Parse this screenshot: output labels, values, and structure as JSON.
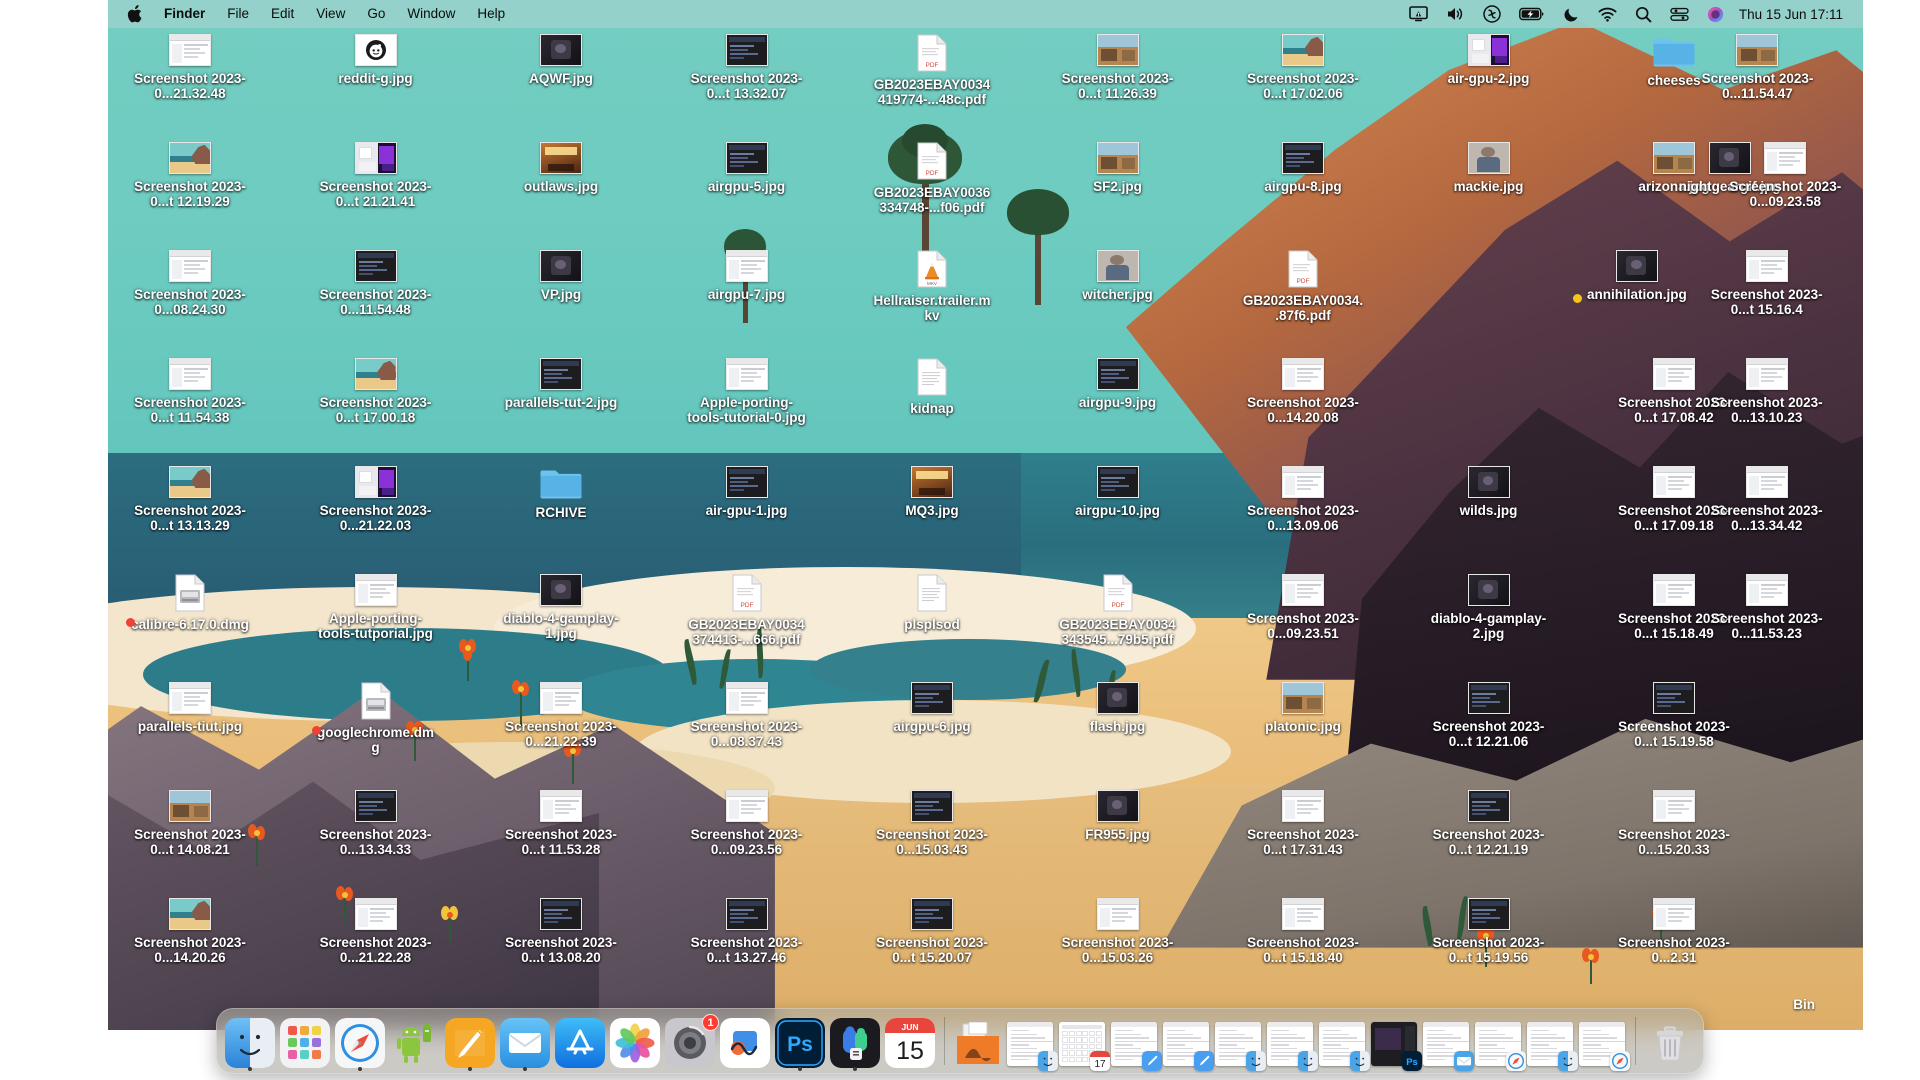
{
  "menubar": {
    "apple_icon": "apple-logo-icon",
    "items": [
      {
        "label": "Finder",
        "bold": true
      },
      {
        "label": "File",
        "bold": false
      },
      {
        "label": "Edit",
        "bold": false
      },
      {
        "label": "View",
        "bold": false
      },
      {
        "label": "Go",
        "bold": false
      },
      {
        "label": "Window",
        "bold": false
      },
      {
        "label": "Help",
        "bold": false
      }
    ],
    "status_icons": [
      "screen-mirroring-icon",
      "volume-icon",
      "creative-cloud-icon",
      "battery-charging-icon",
      "do-not-disturb-moon-icon",
      "wifi-icon",
      "spotlight-search-icon",
      "control-center-icon",
      "siri-icon"
    ],
    "clock": "Thu 15 Jun  17:11"
  },
  "desktop": {
    "icons": [
      {
        "name": "Screenshot 2023-0...21.32.48",
        "type": "screenshot-light",
        "col": 0,
        "row": 0
      },
      {
        "name": "reddit-g.jpg",
        "type": "reddit",
        "col": 1,
        "row": 0
      },
      {
        "name": "AQWF.jpg",
        "type": "photo-dark",
        "col": 2,
        "row": 0
      },
      {
        "name": "Screenshot 2023-0...t 13.32.07",
        "type": "screenshot-dark",
        "col": 3,
        "row": 0
      },
      {
        "name": "GB2023EBAY0034419774-...48c.pdf",
        "type": "pdf",
        "col": 4,
        "row": 0
      },
      {
        "name": "Screenshot 2023-0...t 11.26.39",
        "type": "photo-scene",
        "col": 5,
        "row": 0
      },
      {
        "name": "Screenshot 2023-0...t 17.02.06",
        "type": "photo-beach",
        "col": 6,
        "row": 0
      },
      {
        "name": "air-gpu-2.jpg",
        "type": "screenshot-purple",
        "col": 7,
        "row": 0
      },
      {
        "name": "cheeses",
        "type": "folder",
        "col": 8,
        "row": 0
      },
      {
        "name": "Screenshot 2023-0...11.54.47",
        "type": "photo-scene",
        "col": 8.45,
        "row": 0
      },
      {
        "name": "Screenshot 2023-0...t 12.19.29",
        "type": "photo-beach",
        "col": 0,
        "row": 1
      },
      {
        "name": "Screenshot 2023-0...t 21.21.41",
        "type": "screenshot-purple",
        "col": 1,
        "row": 1
      },
      {
        "name": "outlaws.jpg",
        "type": "game-art",
        "col": 2,
        "row": 1
      },
      {
        "name": "airgpu-5.jpg",
        "type": "screenshot-dark",
        "col": 3,
        "row": 1
      },
      {
        "name": "GB2023EBAY0036334748-...f06.pdf",
        "type": "pdf",
        "col": 4,
        "row": 1
      },
      {
        "name": "SF2.jpg",
        "type": "photo-scene",
        "col": 5,
        "row": 1
      },
      {
        "name": "airgpu-8.jpg",
        "type": "screenshot-dark",
        "col": 6,
        "row": 1
      },
      {
        "name": "mackie.jpg",
        "type": "photo-person",
        "col": 7,
        "row": 1
      },
      {
        "name": "arizona.jpg",
        "type": "photo-scene",
        "col": 8,
        "row": 1
      },
      {
        "name": "nightgeargif.jpg",
        "type": "photo-dark",
        "col": 8.3,
        "row": 1
      },
      {
        "name": "Screenshot 2023-0...09.23.58",
        "type": "screenshot-light",
        "col": 8.6,
        "row": 1
      },
      {
        "name": "Screenshot 2023-0...08.24.30",
        "type": "screenshot-light",
        "col": 0,
        "row": 2
      },
      {
        "name": "Screenshot 2023-0...11.54.48",
        "type": "screenshot-dark",
        "col": 1,
        "row": 2
      },
      {
        "name": "VP.jpg",
        "type": "photo-dark",
        "col": 2,
        "row": 2
      },
      {
        "name": "airgpu-7.jpg",
        "type": "screenshot-light",
        "col": 3,
        "row": 2
      },
      {
        "name": "Hellraiser.trailer.mkv",
        "type": "vlc-mkv",
        "col": 4,
        "row": 2
      },
      {
        "name": "witcher.jpg",
        "type": "photo-person",
        "col": 5,
        "row": 2
      },
      {
        "name": "GB2023EBAY0034..87f6.pdf",
        "type": "pdf",
        "col": 6,
        "row": 2
      },
      {
        "name": "annihilation.jpg",
        "type": "photo-dark",
        "col": 7.8,
        "row": 2,
        "dot": "#f5c518"
      },
      {
        "name": "Screenshot 2023-0...t 15.16.4",
        "type": "screenshot-light",
        "col": 8.5,
        "row": 2
      },
      {
        "name": "Screenshot 2023-0...t 11.54.38",
        "type": "screenshot-light",
        "col": 0,
        "row": 3
      },
      {
        "name": "Screenshot 2023-0...t 17.00.18",
        "type": "photo-beach",
        "col": 1,
        "row": 3
      },
      {
        "name": "parallels-tut-2.jpg",
        "type": "screenshot-dark",
        "col": 2,
        "row": 3
      },
      {
        "name": "Apple-porting-tools-tutorial-0.jpg",
        "type": "screenshot-light",
        "col": 3,
        "row": 3
      },
      {
        "name": "kidnap",
        "type": "doc",
        "col": 4,
        "row": 3
      },
      {
        "name": "airgpu-9.jpg",
        "type": "screenshot-dark",
        "col": 5,
        "row": 3
      },
      {
        "name": "Screenshot 2023-0...14.20.08",
        "type": "screenshot-light",
        "col": 6,
        "row": 3
      },
      {
        "name": "Screenshot 2023-0...t 17.08.42",
        "type": "screenshot-light",
        "col": 8,
        "row": 3
      },
      {
        "name": "Screenshot 2023-0...13.10.23",
        "type": "screenshot-light",
        "col": 8.5,
        "row": 3
      },
      {
        "name": "Screenshot 2023-0...t 13.13.29",
        "type": "photo-beach",
        "col": 0,
        "row": 4
      },
      {
        "name": "Screenshot 2023-0...21.22.03",
        "type": "screenshot-purple",
        "col": 1,
        "row": 4
      },
      {
        "name": "RCHIVE",
        "type": "folder",
        "col": 2,
        "row": 4
      },
      {
        "name": "air-gpu-1.jpg",
        "type": "screenshot-dark",
        "col": 3,
        "row": 4
      },
      {
        "name": "MQ3.jpg",
        "type": "game-art",
        "col": 4,
        "row": 4
      },
      {
        "name": "airgpu-10.jpg",
        "type": "screenshot-dark",
        "col": 5,
        "row": 4
      },
      {
        "name": "Screenshot 2023-0...13.09.06",
        "type": "screenshot-light",
        "col": 6,
        "row": 4
      },
      {
        "name": "wilds.jpg",
        "type": "photo-dark",
        "col": 7,
        "row": 4
      },
      {
        "name": "Screenshot 2023-0...t 17.09.18",
        "type": "screenshot-light",
        "col": 8,
        "row": 4
      },
      {
        "name": "Screenshot 2023-0...13.34.42",
        "type": "screenshot-light",
        "col": 8.5,
        "row": 4
      },
      {
        "name": "calibre-6.17.0.dmg",
        "type": "dmg",
        "col": 0,
        "row": 5,
        "dot": "#ef4136"
      },
      {
        "name": "Apple-porting-tools-tutporial.jpg",
        "type": "screenshot-light",
        "col": 1,
        "row": 5
      },
      {
        "name": "diablo-4-gamplay-1.jpg",
        "type": "photo-dark",
        "col": 2,
        "row": 5
      },
      {
        "name": "GB2023EBAY0034374413-...666.pdf",
        "type": "pdf",
        "col": 3,
        "row": 5
      },
      {
        "name": "plsplsod",
        "type": "doc",
        "col": 4,
        "row": 5
      },
      {
        "name": "GB2023EBAY0034343545...79b5.pdf",
        "type": "pdf",
        "col": 5,
        "row": 5
      },
      {
        "name": "Screenshot 2023-0...09.23.51",
        "type": "screenshot-light",
        "col": 6,
        "row": 5
      },
      {
        "name": "diablo-4-gamplay-2.jpg",
        "type": "photo-dark",
        "col": 7,
        "row": 5
      },
      {
        "name": "Screenshot 2023-0...t 15.18.49",
        "type": "screenshot-light",
        "col": 8,
        "row": 5
      },
      {
        "name": "Screenshot 2023-0...11.53.23",
        "type": "screenshot-light",
        "col": 8.5,
        "row": 5
      },
      {
        "name": "parallels-tiut.jpg",
        "type": "screenshot-light",
        "col": 0,
        "row": 6
      },
      {
        "name": "googlechrome.dmg",
        "type": "dmg",
        "col": 1,
        "row": 6,
        "dot": "#ef4136"
      },
      {
        "name": "Screenshot 2023-0...21.22.39",
        "type": "screenshot-light",
        "col": 2,
        "row": 6
      },
      {
        "name": "Screenshot 2023-0...08.37.43",
        "type": "screenshot-light",
        "col": 3,
        "row": 6
      },
      {
        "name": "airgpu-6.jpg",
        "type": "screenshot-dark",
        "col": 4,
        "row": 6
      },
      {
        "name": "flash.jpg",
        "type": "photo-dark",
        "col": 5,
        "row": 6
      },
      {
        "name": "platonic.jpg",
        "type": "photo-scene",
        "col": 6,
        "row": 6
      },
      {
        "name": "Screenshot 2023-0...t 12.21.06",
        "type": "screenshot-dark",
        "col": 7,
        "row": 6
      },
      {
        "name": "Screenshot 2023-0...t 15.19.58",
        "type": "screenshot-dark",
        "col": 8,
        "row": 6
      },
      {
        "name": "Screenshot 2023-0...t 14.08.21",
        "type": "photo-scene",
        "col": 0,
        "row": 7
      },
      {
        "name": "Screenshot 2023-0...13.34.33",
        "type": "screenshot-dark",
        "col": 1,
        "row": 7
      },
      {
        "name": "Screenshot 2023-0...t 11.53.28",
        "type": "screenshot-light",
        "col": 2,
        "row": 7
      },
      {
        "name": "Screenshot 2023-0...09.23.56",
        "type": "screenshot-light",
        "col": 3,
        "row": 7
      },
      {
        "name": "Screenshot 2023-0...15.03.43",
        "type": "screenshot-dark",
        "col": 4,
        "row": 7
      },
      {
        "name": "FR955.jpg",
        "type": "photo-dark",
        "col": 5,
        "row": 7
      },
      {
        "name": "Screenshot 2023-0...t 17.31.43",
        "type": "screenshot-light",
        "col": 6,
        "row": 7
      },
      {
        "name": "Screenshot 2023-0...t 12.21.19",
        "type": "screenshot-dark",
        "col": 7,
        "row": 7
      },
      {
        "name": "Screenshot 2023-0...15.20.33",
        "type": "screenshot-light",
        "col": 8,
        "row": 7
      },
      {
        "name": "Screenshot 2023-0...14.20.26",
        "type": "photo-beach",
        "col": 0,
        "row": 8
      },
      {
        "name": "Screenshot 2023-0...21.22.28",
        "type": "screenshot-light",
        "col": 1,
        "row": 8
      },
      {
        "name": "Screenshot 2023-0...t 13.08.20",
        "type": "screenshot-dark",
        "col": 2,
        "row": 8
      },
      {
        "name": "Screenshot 2023-0...t 13.27.46",
        "type": "screenshot-dark",
        "col": 3,
        "row": 8
      },
      {
        "name": "Screenshot 2023-0...t 15.20.07",
        "type": "screenshot-dark",
        "col": 4,
        "row": 8
      },
      {
        "name": "Screenshot 2023-0...15.03.26",
        "type": "screenshot-light",
        "col": 5,
        "row": 8
      },
      {
        "name": "Screenshot 2023-0...t 15.18.40",
        "type": "screenshot-light",
        "col": 6,
        "row": 8
      },
      {
        "name": "Screenshot 2023-0...t 15.19.56",
        "type": "screenshot-dark",
        "col": 7,
        "row": 8
      },
      {
        "name": "Screenshot 2023-0...2.31",
        "type": "screenshot-light",
        "col": 8,
        "row": 8
      }
    ],
    "bin_label": "Bin"
  },
  "dock": {
    "apps": [
      {
        "name": "Finder",
        "icon": "finder-icon",
        "running": true
      },
      {
        "name": "Launchpad",
        "icon": "launchpad-icon",
        "running": false
      },
      {
        "name": "Safari",
        "icon": "safari-icon",
        "running": true
      },
      {
        "name": "Android File Transfer",
        "icon": "android-icon",
        "running": false
      },
      {
        "name": "Notes",
        "icon": "notes-icon",
        "running": true
      },
      {
        "name": "Mail",
        "icon": "mail-icon",
        "running": true
      },
      {
        "name": "App Store",
        "icon": "app-store-icon",
        "running": false
      },
      {
        "name": "Photos",
        "icon": "photos-icon",
        "running": false
      },
      {
        "name": "System Settings",
        "icon": "system-settings-icon",
        "running": false,
        "badge": "1"
      },
      {
        "name": "Freeform",
        "icon": "freeform-icon",
        "running": false
      },
      {
        "name": "Adobe Photoshop",
        "icon": "photoshop-icon",
        "running": true
      },
      {
        "name": "Microsoft Teams",
        "icon": "teams-icon",
        "running": true
      },
      {
        "name": "Calendar",
        "icon": "calendar-icon",
        "running": false,
        "month": "JUN",
        "day": "15"
      }
    ],
    "minimized": [
      {
        "name": "downloads-stack",
        "icon": "downloads-folder-icon"
      },
      {
        "name": "finder-window-1",
        "badge": "finder-badge"
      },
      {
        "name": "calendar-window",
        "badge": "calendar-badge",
        "day": "17"
      },
      {
        "name": "notes-window-1",
        "badge": "notes-badge"
      },
      {
        "name": "notes-window-2",
        "badge": "notes-badge"
      },
      {
        "name": "finder-window-2",
        "badge": "finder-badge"
      },
      {
        "name": "finder-window-3",
        "badge": "finder-badge"
      },
      {
        "name": "finder-window-4",
        "badge": "finder-badge"
      },
      {
        "name": "photoshop-window",
        "badge": "photoshop-badge"
      },
      {
        "name": "mail-window",
        "badge": "mail-badge"
      },
      {
        "name": "safari-window",
        "badge": "safari-badge"
      },
      {
        "name": "finder-window-5",
        "badge": "finder-badge"
      },
      {
        "name": "safari-window-2",
        "badge": "safari-badge"
      }
    ],
    "trash": {
      "name": "Trash",
      "icon": "trash-icon"
    }
  }
}
